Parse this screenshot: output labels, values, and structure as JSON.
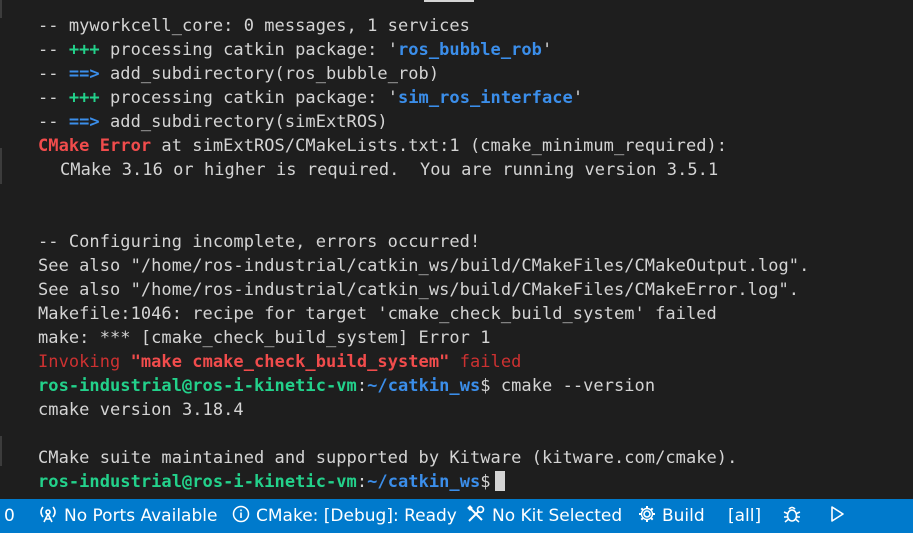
{
  "terminal": {
    "lines": [
      {
        "kind": "plain",
        "text": "-- myworkcell_core: 0 messages, 1 services"
      },
      {
        "kind": "processing",
        "prefix": "-- ",
        "marker": "+++",
        "middle": " processing catkin package: '",
        "name": "ros_bubble_rob",
        "suffix": "'"
      },
      {
        "kind": "subdir",
        "prefix": "-- ",
        "marker": "==>",
        "rest": " add_subdirectory(ros_bubble_rob)"
      },
      {
        "kind": "processing",
        "prefix": "-- ",
        "marker": "+++",
        "middle": " processing catkin package: '",
        "name": "sim_ros_interface",
        "suffix": "'"
      },
      {
        "kind": "subdir",
        "prefix": "-- ",
        "marker": "==>",
        "rest": " add_subdirectory(simExtROS)"
      },
      {
        "kind": "cmake-error",
        "error": "CMake Error",
        "rest": " at simExtROS/CMakeLists.txt:1 (cmake_minimum_required):"
      },
      {
        "kind": "indent",
        "text": "CMake 3.16 or higher is required.  You are running version 3.5.1"
      },
      {
        "kind": "blank",
        "text": ""
      },
      {
        "kind": "blank",
        "text": ""
      },
      {
        "kind": "plain",
        "text": "-- Configuring incomplete, errors occurred!"
      },
      {
        "kind": "plain",
        "text": "See also \"/home/ros-industrial/catkin_ws/build/CMakeFiles/CMakeOutput.log\"."
      },
      {
        "kind": "plain",
        "text": "See also \"/home/ros-industrial/catkin_ws/build/CMakeFiles/CMakeError.log\"."
      },
      {
        "kind": "plain",
        "text": "Makefile:1046: recipe for target 'cmake_check_build_system' failed"
      },
      {
        "kind": "plain",
        "text": "make: *** [cmake_check_build_system] Error 1"
      },
      {
        "kind": "invoking",
        "pre": "Invoking ",
        "cmd": "\"make cmake_check_build_system\"",
        "post": " failed"
      },
      {
        "kind": "prompt",
        "user": "ros-industrial@ros-i-kinetic-vm",
        "sep": ":",
        "path": "~/catkin_ws",
        "dollar": "$ ",
        "cmd": "cmake --version"
      },
      {
        "kind": "plain",
        "text": "cmake version 3.18.4"
      },
      {
        "kind": "blank",
        "text": ""
      },
      {
        "kind": "plain",
        "text": "CMake suite maintained and supported by Kitware (kitware.com/cmake)."
      },
      {
        "kind": "prompt-cursor",
        "user": "ros-industrial@ros-i-kinetic-vm",
        "sep": ":",
        "path": "~/catkin_ws",
        "dollar": "$",
        "cmd": ""
      }
    ]
  },
  "statusbar": {
    "problems_count": "0",
    "ports": {
      "icon": "antenna-icon",
      "label": "No Ports Available"
    },
    "cmake": {
      "icon": "info-icon",
      "label": "CMake: [Debug]: Ready"
    },
    "kit": {
      "icon": "tools-icon",
      "label": "No Kit Selected"
    },
    "build": {
      "icon": "gear-icon",
      "label": "Build"
    },
    "target": {
      "label": "[all]"
    },
    "debug": {
      "icon": "bug-icon"
    },
    "run": {
      "icon": "play-icon"
    }
  },
  "colors": {
    "background": "#1e1e1e",
    "statusbar": "#007acc",
    "green": "#23d18b",
    "blue": "#3b8eea",
    "red": "#f14c4c"
  }
}
